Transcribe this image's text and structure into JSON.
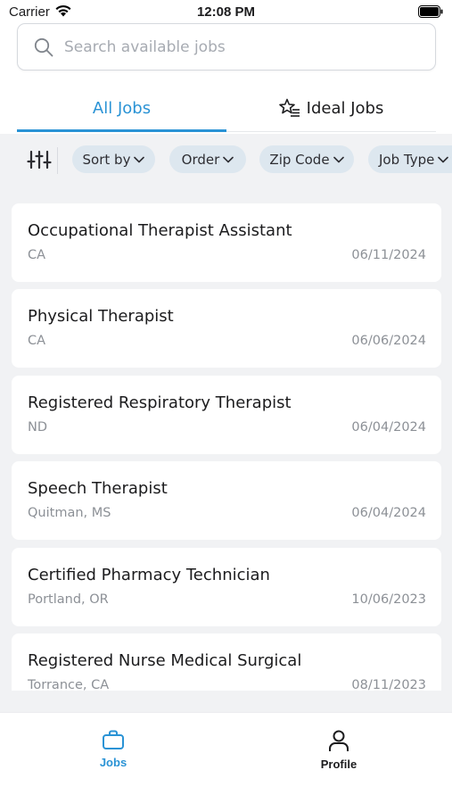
{
  "status_bar": {
    "carrier": "Carrier",
    "time": "12:08 PM"
  },
  "search": {
    "placeholder": "Search available jobs",
    "value": ""
  },
  "tabs": [
    {
      "label": "All Jobs",
      "active": true
    },
    {
      "label": "Ideal Jobs",
      "active": false,
      "icon": "star-list-icon"
    }
  ],
  "filters": {
    "icon": "sliders-icon",
    "chips": [
      {
        "label": "Sort by"
      },
      {
        "label": "Order"
      },
      {
        "label": "Zip Code"
      },
      {
        "label": "Job Type"
      }
    ]
  },
  "jobs": [
    {
      "title": "Occupational Therapist Assistant",
      "location": "CA",
      "date": "06/11/2024"
    },
    {
      "title": "Physical Therapist",
      "location": "CA",
      "date": "06/06/2024"
    },
    {
      "title": "Registered Respiratory Therapist",
      "location": "ND",
      "date": "06/04/2024"
    },
    {
      "title": "Speech Therapist",
      "location": "Quitman, MS",
      "date": "06/04/2024"
    },
    {
      "title": "Certified Pharmacy Technician",
      "location": "Portland, OR",
      "date": "10/06/2023"
    },
    {
      "title": "Registered Nurse Medical Surgical",
      "location": "Torrance, CA",
      "date": "08/11/2023"
    }
  ],
  "bottom_nav": [
    {
      "label": "Jobs",
      "icon": "briefcase-icon",
      "active": true
    },
    {
      "label": "Profile",
      "icon": "person-icon",
      "active": false
    }
  ],
  "colors": {
    "accent": "#2a93d5",
    "background": "#f1f2f4",
    "chip": "#dde7ef"
  }
}
